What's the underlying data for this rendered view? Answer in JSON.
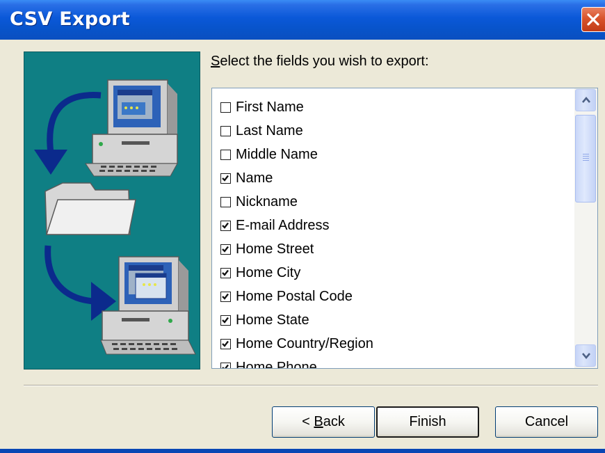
{
  "window": {
    "title": "CSV Export",
    "accent": "#0a58d8",
    "close_color": "#d8542c"
  },
  "instruction": {
    "mnemonic": "S",
    "rest": "elect the fields you wish to export:"
  },
  "fields": [
    {
      "label": "First Name",
      "checked": false
    },
    {
      "label": "Last Name",
      "checked": false
    },
    {
      "label": "Middle Name",
      "checked": false
    },
    {
      "label": "Name",
      "checked": true
    },
    {
      "label": "Nickname",
      "checked": false
    },
    {
      "label": "E-mail Address",
      "checked": true
    },
    {
      "label": "Home Street",
      "checked": true
    },
    {
      "label": "Home City",
      "checked": true
    },
    {
      "label": "Home Postal Code",
      "checked": true
    },
    {
      "label": "Home State",
      "checked": true
    },
    {
      "label": "Home Country/Region",
      "checked": true
    },
    {
      "label": "Home Phone",
      "checked": true
    }
  ],
  "buttons": {
    "back_prefix": "< ",
    "back_mnemonic": "B",
    "back_rest": "ack",
    "finish": "Finish",
    "cancel": "Cancel"
  },
  "icons": {
    "close": "close-icon",
    "scroll_up": "chevron-up-icon",
    "scroll_down": "chevron-down-icon",
    "checkmark": "checkmark-icon",
    "wizard_art": [
      "computer-icon",
      "arrow-icon",
      "folder-icon"
    ]
  },
  "art_colors": {
    "panel": "#0f7f84",
    "arrow": "#0b2a8c"
  }
}
